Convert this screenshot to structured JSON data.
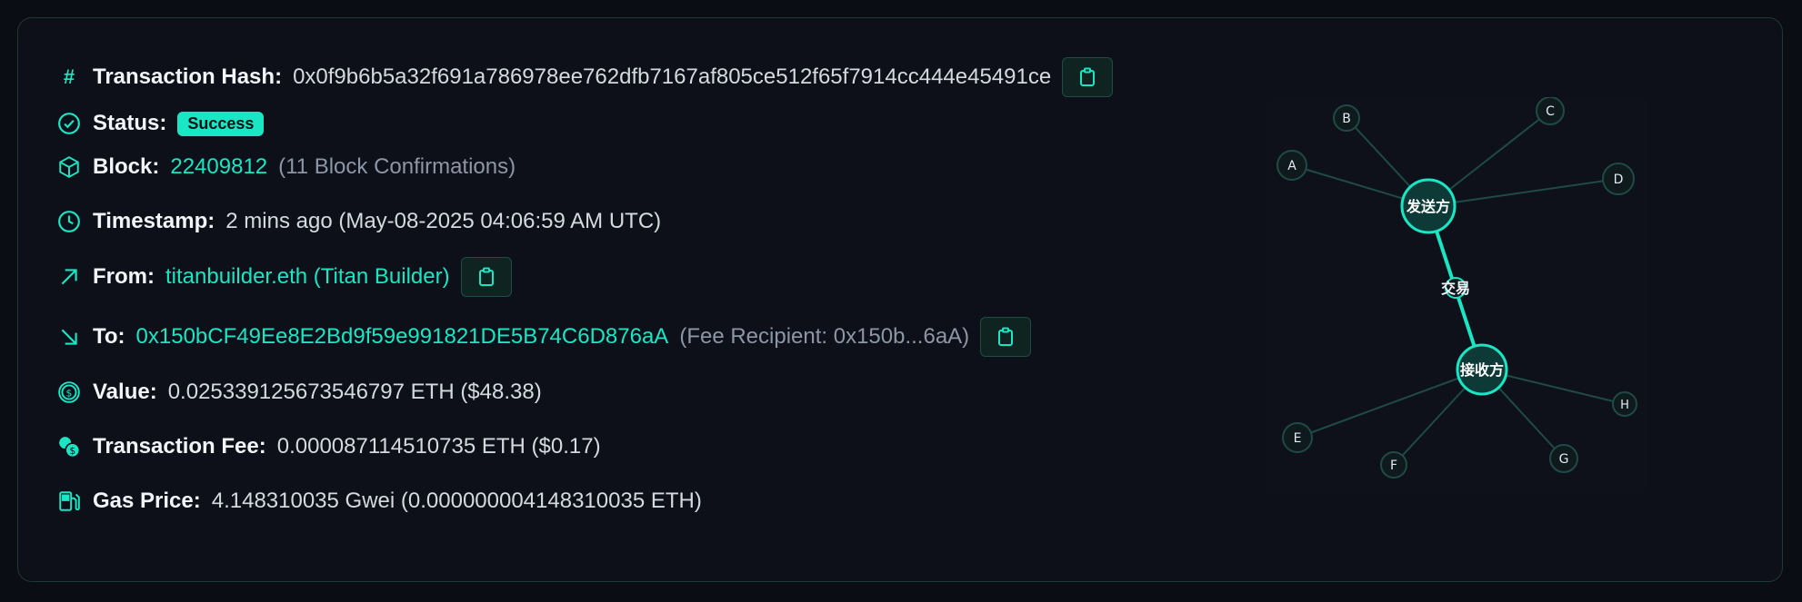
{
  "tx": {
    "hash_label": "Transaction Hash:",
    "hash_value": "0x0f9b6b5a32f691a786978ee762dfb7167af805ce512f65f7914cc444e45491ce",
    "status_label": "Status:",
    "status_value": "Success",
    "block_label": "Block:",
    "block_value": "22409812",
    "block_confirmations": "(11 Block Confirmations)",
    "timestamp_label": "Timestamp:",
    "timestamp_value": "2 mins ago (May-08-2025 04:06:59 AM UTC)",
    "from_label": "From:",
    "from_value": "titanbuilder.eth (Titan Builder)",
    "to_label": "To:",
    "to_value": "0x150bCF49Ee8E2Bd9f59e991821DE5B74C6D876aA",
    "to_note": "(Fee Recipient: 0x150b...6aA)",
    "value_label": "Value:",
    "value_value": "0.025339125673546797 ETH ($48.38)",
    "fee_label": "Transaction Fee:",
    "fee_value": "0.000087114510735 ETH ($0.17)",
    "gas_label": "Gas Price:",
    "gas_value": "4.148310035 Gwei (0.000000004148310035 ETH)"
  },
  "graph": {
    "sender_label": "发送方",
    "receiver_label": "接收方",
    "tx_label": "交易",
    "nodes": [
      "A",
      "B",
      "C",
      "D",
      "E",
      "F",
      "G",
      "H"
    ]
  },
  "colors": {
    "accent": "#19e6c4",
    "background": "#0b0d14",
    "card_border": "#1c3a36",
    "muted_text": "#8d96a6"
  },
  "icons": {
    "hash": "hash-icon",
    "status": "check-circle-icon",
    "block": "cube-icon",
    "timestamp": "clock-icon",
    "from": "arrow-up-right-icon",
    "to": "arrow-down-right-icon",
    "value": "dollar-circle-icon",
    "fee": "coins-icon",
    "gas": "gas-pump-icon",
    "copy": "clipboard-icon"
  }
}
